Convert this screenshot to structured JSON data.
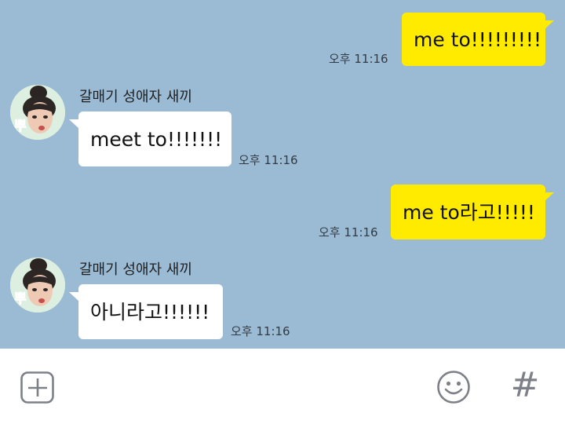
{
  "messages": [
    {
      "type": "sent",
      "text": "me to!!!!!!!!!",
      "time": "오후 11:16"
    },
    {
      "type": "received",
      "sender": "갈매기 성애자 새끼",
      "text": "meet to!!!!!!!",
      "time": "오후 11:16"
    },
    {
      "type": "sent",
      "text": "me to라고!!!!!",
      "time": "오후 11:16"
    },
    {
      "type": "received",
      "sender": "갈매기 성애자 새끼",
      "text": "아니라고!!!!!!",
      "time": "오후 11:16"
    }
  ],
  "avatar": {
    "sticker_text": "뿌"
  },
  "input_bar": {
    "icons": [
      "plus-icon",
      "emoji-icon",
      "hash-icon"
    ],
    "hash_glyph": "#"
  },
  "colors": {
    "chat_background": "#9bbbd4",
    "sent_bubble": "#ffeb00",
    "received_bubble": "#ffffff"
  }
}
